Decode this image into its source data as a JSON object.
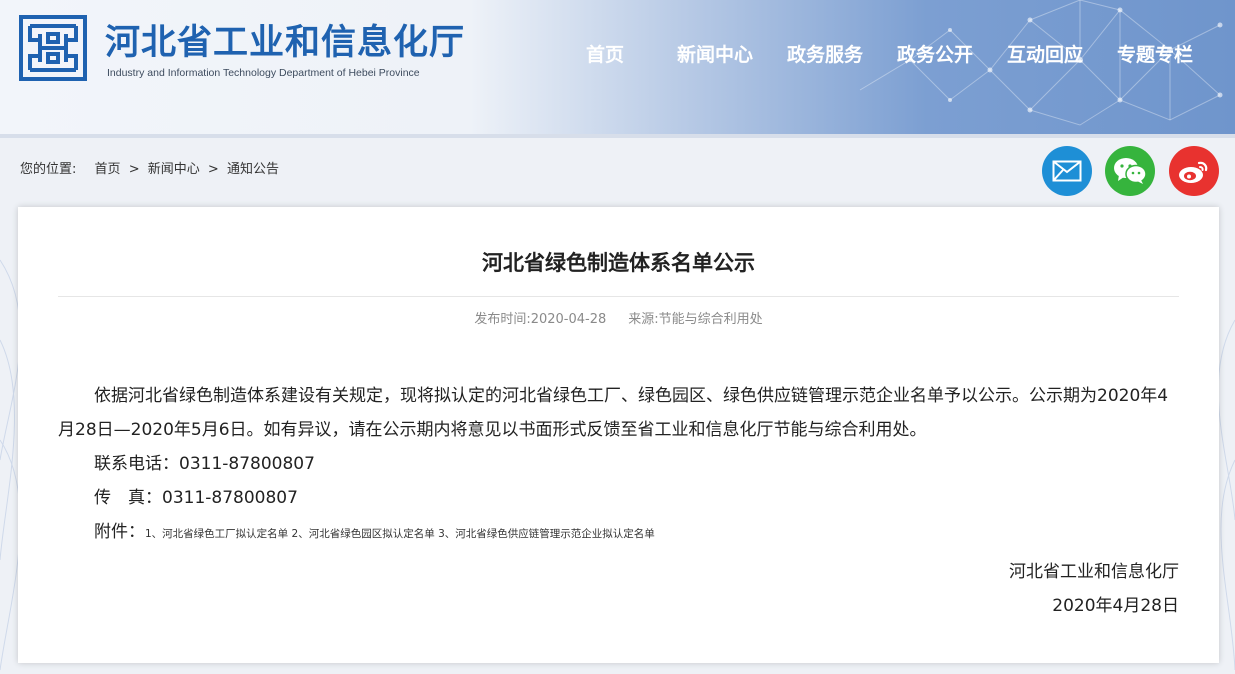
{
  "header": {
    "title": "河北省工业和信息化厅",
    "subtitle": "Industry and Information Technology Department of Hebei Province",
    "logo_icon": "hebei-emblem-icon",
    "colors": {
      "brand_blue": "#1f62b0",
      "nav_text": "#ffffff"
    }
  },
  "nav": {
    "items": [
      {
        "label": "首页"
      },
      {
        "label": "新闻中心"
      },
      {
        "label": "政务服务"
      },
      {
        "label": "政务公开"
      },
      {
        "label": "互动回应"
      },
      {
        "label": "专题专栏"
      }
    ]
  },
  "breadcrumb": {
    "label": "您的位置:",
    "items": [
      "首页",
      "新闻中心",
      "通知公告"
    ],
    "separator": ">"
  },
  "share": {
    "icons": [
      "mail-icon",
      "wechat-icon",
      "weibo-icon"
    ],
    "colors": {
      "mail": "#1e8fd6",
      "wechat": "#36b43d",
      "weibo": "#e8322f"
    }
  },
  "article": {
    "title": "河北省绿色制造体系名单公示",
    "meta": {
      "publish_label": "发布时间:",
      "publish_date": "2020-04-28",
      "source_label": "来源:",
      "source": "节能与综合利用处"
    },
    "paragraph": "依据河北省绿色制造体系建设有关规定，现将拟认定的河北省绿色工厂、绿色园区、绿色供应链管理示范企业名单予以公示。公示期为2020年4月28日—2020年5月6日。如有异议，请在公示期内将意见以书面形式反馈至省工业和信息化厅节能与综合利用处。",
    "phone_line": "联系电话：0311-87800807",
    "fax_line": "传　真：0311-87800807",
    "attachments_label": "附件：",
    "attachments": [
      "1、河北省绿色工厂拟认定名单",
      "2、河北省绿色园区拟认定名单",
      "3、河北省绿色供应链管理示范企业拟认定名单"
    ],
    "signature": "河北省工业和信息化厅",
    "sign_date": "2020年4月28日"
  }
}
